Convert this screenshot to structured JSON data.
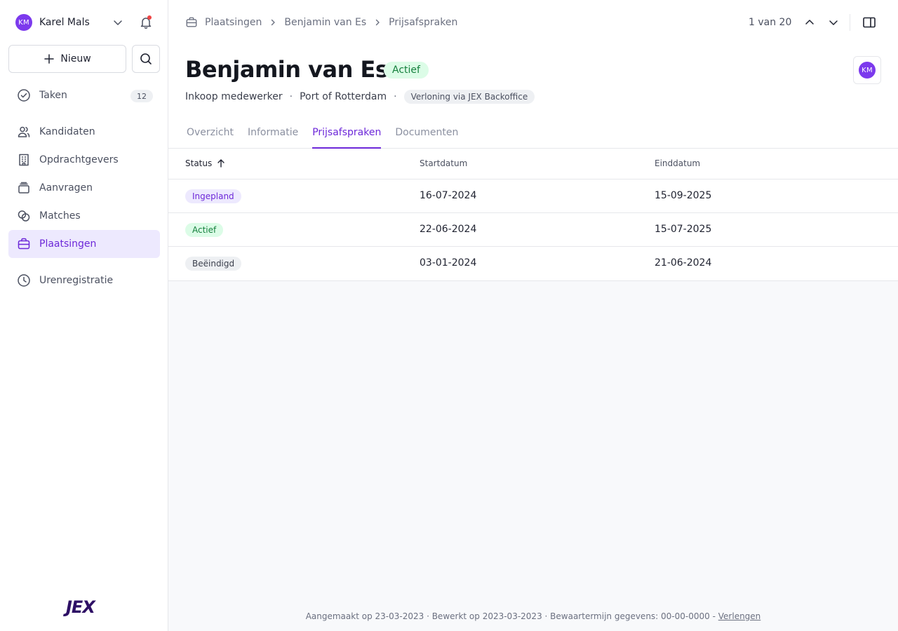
{
  "user": {
    "initials": "KM",
    "name": "Karel Mals"
  },
  "sidebar": {
    "new_label": "Nieuw",
    "items": [
      {
        "label": "Taken",
        "count": "12"
      },
      {
        "label": "Kandidaten"
      },
      {
        "label": "Opdrachtgevers"
      },
      {
        "label": "Aanvragen"
      },
      {
        "label": "Matches"
      },
      {
        "label": "Plaatsingen"
      },
      {
        "label": "Urenregistratie"
      }
    ],
    "active": "Plaatsingen",
    "logo": "JEX"
  },
  "breadcrumb": [
    "Plaatsingen",
    "Benjamin van Es",
    "Prijsafspraken"
  ],
  "pager": {
    "label": "1 van 20"
  },
  "record": {
    "title": "Benjamin van Es",
    "status": "Actief",
    "owner_initials": "KM",
    "role": "Inkoop medewerker",
    "company": "Port of Rotterdam",
    "payroll_tag": "Verloning via JEX Backoffice"
  },
  "tabs": [
    "Overzicht",
    "Informatie",
    "Prijsafspraken",
    "Documenten"
  ],
  "active_tab": "Prijsafspraken",
  "table": {
    "columns": [
      "Status",
      "Startdatum",
      "Einddatum"
    ],
    "rows": [
      {
        "status": "Ingepland",
        "start": "16-07-2024",
        "end": "15-09-2025"
      },
      {
        "status": "Actief",
        "start": "22-06-2024",
        "end": "15-07-2025"
      },
      {
        "status": "Beëindigd",
        "start": "03-01-2024",
        "end": "21-06-2024"
      }
    ]
  },
  "footer": {
    "created": "Aangemaakt op 23-03-2023",
    "edited": "Bewerkt op 2023-03-2023",
    "retention": "Bewaartermijn gegevens: 00-00-0000",
    "extend_link": "Verlengen"
  },
  "colors": {
    "accent": "#6d28d9",
    "avatar": "#7c3aed",
    "active_nav_bg": "#ede9fe",
    "success_bg": "#dcfce7",
    "success_text": "#15803d",
    "notification_dot": "#ef4444",
    "logo": "#2e1065"
  }
}
